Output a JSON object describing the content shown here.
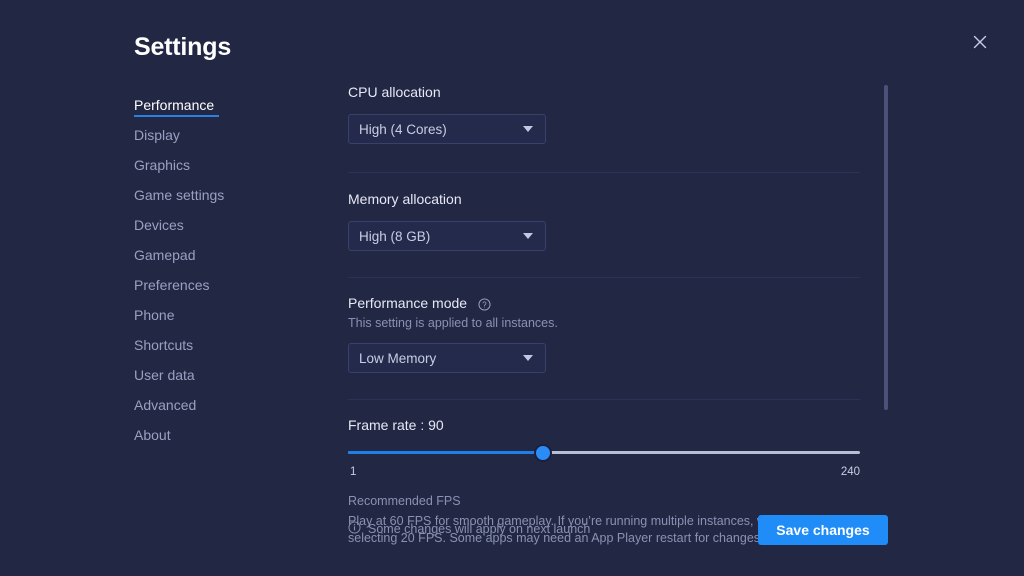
{
  "window": {
    "title": "Settings",
    "close_icon": "close-icon"
  },
  "sidebar": {
    "items": [
      {
        "label": "Performance",
        "active": true
      },
      {
        "label": "Display",
        "active": false
      },
      {
        "label": "Graphics",
        "active": false
      },
      {
        "label": "Game settings",
        "active": false
      },
      {
        "label": "Devices",
        "active": false
      },
      {
        "label": "Gamepad",
        "active": false
      },
      {
        "label": "Preferences",
        "active": false
      },
      {
        "label": "Phone",
        "active": false
      },
      {
        "label": "Shortcuts",
        "active": false
      },
      {
        "label": "User data",
        "active": false
      },
      {
        "label": "Advanced",
        "active": false
      },
      {
        "label": "About",
        "active": false
      }
    ]
  },
  "main": {
    "cpu": {
      "label": "CPU allocation",
      "value": "High (4 Cores)",
      "caret_icon": "chevron-down-icon"
    },
    "memory": {
      "label": "Memory allocation",
      "value": "High (8 GB)",
      "caret_icon": "chevron-down-icon"
    },
    "performance_mode": {
      "label": "Performance mode",
      "help_icon": "help-circle-icon",
      "sublabel": "This setting is applied to all instances.",
      "value": "Low Memory",
      "caret_icon": "chevron-down-icon"
    },
    "frame_rate": {
      "label": "Frame rate : 90",
      "value": 90,
      "min": 1,
      "max": 240,
      "min_label": "1",
      "max_label": "240",
      "fill_percent": 38,
      "recommended_title": "Recommended FPS",
      "recommended_body": "Play at 60 FPS for smooth gameplay. If you’re running multiple instances, we recommend selecting 20 FPS. Some apps may need an App Player restart for changes to take effect."
    }
  },
  "footer": {
    "info_icon": "info-circle-icon",
    "note": "Some changes will apply on next launch",
    "save_label": "Save changes"
  },
  "colors": {
    "background": "#222744",
    "accent": "#1f8cf8",
    "slider_fill": "#1f7fe8",
    "text_primary": "#e6e9f5",
    "text_muted": "#8b91b2"
  }
}
